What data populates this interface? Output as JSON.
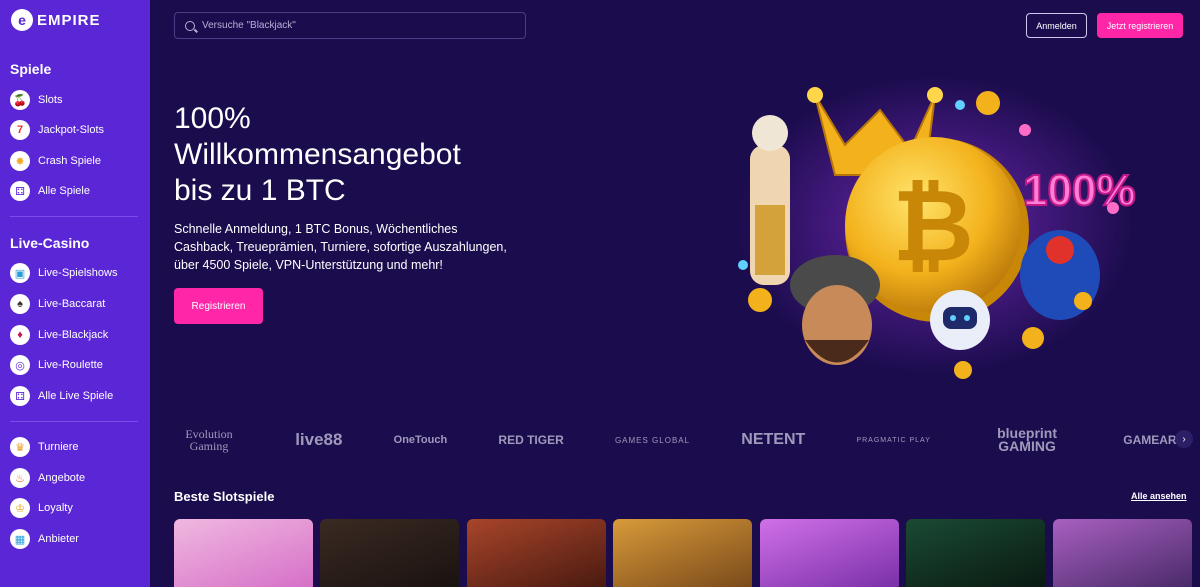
{
  "brand": {
    "name": "EMPIRE",
    "mark": "e"
  },
  "sidebar": {
    "sections": [
      {
        "title": "Spiele",
        "items": [
          {
            "label": "Slots",
            "icon": "cherries-icon"
          },
          {
            "label": "Jackpot-Slots",
            "icon": "lucky-seven-icon"
          },
          {
            "label": "Crash Spiele",
            "icon": "explosion-icon"
          },
          {
            "label": "Alle Spiele",
            "icon": "grid-icon"
          }
        ]
      },
      {
        "title": "Live-Casino",
        "items": [
          {
            "label": "Live-Spielshows",
            "icon": "tv-icon"
          },
          {
            "label": "Live-Baccarat",
            "icon": "cards-icon"
          },
          {
            "label": "Live-Blackjack",
            "icon": "playing-card-icon"
          },
          {
            "label": "Live-Roulette",
            "icon": "roulette-icon"
          },
          {
            "label": "Alle Live Spiele",
            "icon": "grid-icon"
          }
        ]
      },
      {
        "title": "",
        "items": [
          {
            "label": "Turniere",
            "icon": "trophy-icon"
          },
          {
            "label": "Angebote",
            "icon": "fire-icon"
          },
          {
            "label": "Loyalty",
            "icon": "crown-icon"
          },
          {
            "label": "Anbieter",
            "icon": "slot-machine-icon"
          }
        ]
      }
    ]
  },
  "header": {
    "search_placeholder": "Versuche \"Blackjack\"",
    "login_label": "Anmelden",
    "register_label": "Jetzt registrieren"
  },
  "hero": {
    "title_lines": [
      "100%",
      "Willkommensangebot",
      "bis zu 1 BTC"
    ],
    "description": "Schnelle Anmeldung, 1 BTC Bonus, Wöchentliches Cashback, Treueprämien, Turniere, sofortige Auszahlungen, über 4500 Spiele, VPN-Unterstützung und mehr!",
    "cta_label": "Registrieren",
    "badge_text": "100%"
  },
  "providers": [
    "Evolution Gaming",
    "live88",
    "OneTouch",
    "RED TIGER",
    "GAMES GLOBAL",
    "NETENT",
    "PRAGMATIC PLAY",
    "blueprint GAMING",
    "GAMEART"
  ],
  "slots": {
    "title": "Beste Slotspiele",
    "view_all_label": "Alle ansehen",
    "tiles": [
      {
        "name": "tile-1",
        "color": "#e9a3d6"
      },
      {
        "name": "tile-2",
        "color": "#2a1b18"
      },
      {
        "name": "tile-3",
        "color": "#8b2f1c"
      },
      {
        "name": "tile-4",
        "color": "#b8772e"
      },
      {
        "name": "tile-5",
        "color": "#b04bc8"
      },
      {
        "name": "tile-6",
        "color": "#123a2a"
      },
      {
        "name": "tile-7",
        "color": "#7a3f8c"
      }
    ]
  },
  "colors": {
    "sidebar": "#5b26d6",
    "background": "#1b0c4d",
    "accent": "#ff27a8"
  }
}
